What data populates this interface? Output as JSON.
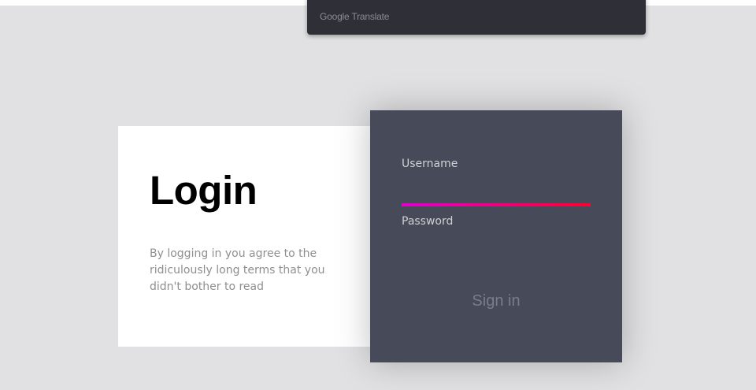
{
  "translate_bar": {
    "brand_google": "Google",
    "brand_translate": "Translate"
  },
  "login_panel": {
    "title": "Login",
    "terms": "By logging in you agree to the ridiculously long terms that you didn't bother to read"
  },
  "form": {
    "username_label": "Username",
    "username_value": "",
    "password_label": "Password",
    "password_value": "",
    "signin_label": "Sign in"
  },
  "colors": {
    "page_bg": "#e1e1e3",
    "form_bg": "#474a59",
    "accent_gradient_start": "#e000d0",
    "accent_gradient_end": "#ff0030"
  }
}
